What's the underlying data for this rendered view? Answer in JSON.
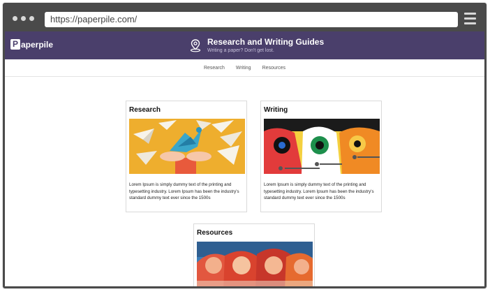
{
  "browser": {
    "url": "https://paperpile.com/"
  },
  "header": {
    "logo_text": "aperpile",
    "logo_letter": "P",
    "title": "Research and Writing Guides",
    "subtitle": "Writing a paper? Don't get lost."
  },
  "nav": {
    "items": [
      "Research",
      "Writing",
      "Resources"
    ]
  },
  "cards": [
    {
      "title": "Research",
      "text": "Lorem Ipsum is simply dummy text of the printing and typesetting industry. Lorem Ipsum has been the industry's standard dummy text ever since the 1500s"
    },
    {
      "title": "Writing",
      "text": "Lorem Ipsum is simply dummy text of the printing and typesetting industry. Lorem Ipsum has been the industry's standard dummy text ever since the 1500s"
    },
    {
      "title": "Resources",
      "text": ""
    }
  ],
  "colors": {
    "header_bg": "#4a3f6b",
    "frame": "#4a4a4a"
  }
}
